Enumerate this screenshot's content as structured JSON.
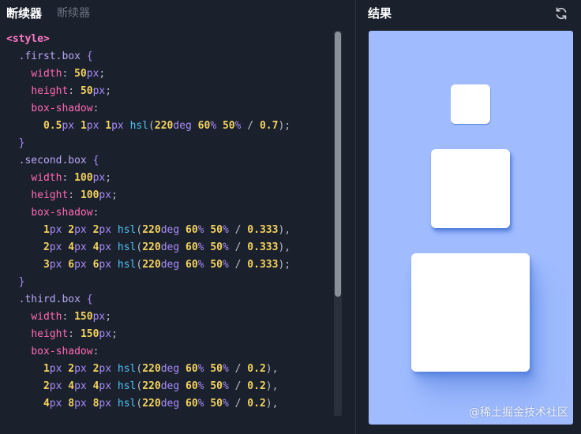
{
  "editor": {
    "tabs": [
      {
        "label": "断续器",
        "active": true
      },
      {
        "label": "断续器",
        "active": false
      }
    ],
    "code": {
      "style_open": "<style>",
      "first": {
        "selector": ".first.box",
        "width_prop": "width",
        "width_num": "50",
        "height_prop": "height",
        "height_num": "50",
        "shadow_prop": "box-shadow",
        "shadow": [
          {
            "x": "0.5",
            "y": "1",
            "b": "1",
            "alpha": "0.7",
            "end": ";"
          }
        ]
      },
      "second": {
        "selector": ".second.box",
        "width_prop": "width",
        "width_num": "100",
        "height_prop": "height",
        "height_num": "100",
        "shadow_prop": "box-shadow",
        "shadow": [
          {
            "x": "1",
            "y": "2",
            "b": "2",
            "alpha": "0.333",
            "end": ","
          },
          {
            "x": "2",
            "y": "4",
            "b": "4",
            "alpha": "0.333",
            "end": ","
          },
          {
            "x": "3",
            "y": "6",
            "b": "6",
            "alpha": "0.333",
            "end": ";"
          }
        ]
      },
      "third": {
        "selector": ".third.box",
        "width_prop": "width",
        "width_num": "150",
        "height_prop": "height",
        "height_num": "150",
        "shadow_prop": "box-shadow",
        "shadow": [
          {
            "x": "1",
            "y": "2",
            "b": "2",
            "alpha": "0.2",
            "end": ","
          },
          {
            "x": "2",
            "y": "4",
            "b": "4",
            "alpha": "0.2",
            "end": ","
          },
          {
            "x": "4",
            "y": "8",
            "b": "8",
            "alpha": "0.2",
            "end": ","
          }
        ]
      },
      "tokens": {
        "px": "px",
        "fn": "hsl",
        "hue": "220",
        "deg": "deg",
        "sat": "60",
        "light": "50",
        "pct": "%",
        "slash": "/",
        "open": "{",
        "close": "}",
        "colon": ":",
        "semi": ";",
        "lparen": "(",
        "rparen": ")"
      }
    }
  },
  "result": {
    "title": "结果",
    "refresh_icon": "refresh-icon",
    "watermark": "@稀土掘金技术社区"
  },
  "colors": {
    "background": "#1b212c",
    "preview_bg": "#a0bcff",
    "box": "#ffffff"
  }
}
